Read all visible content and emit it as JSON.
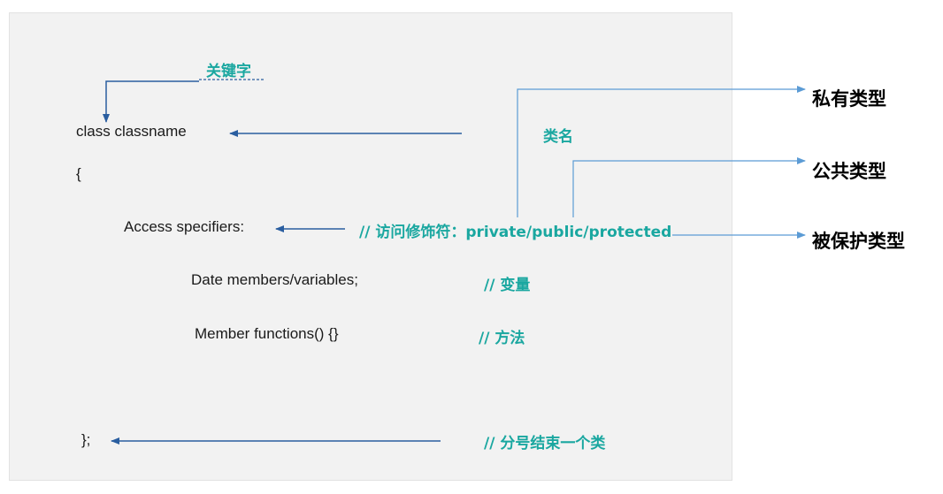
{
  "code": {
    "class_line": "class classname",
    "open_brace": "{",
    "access": "Access specifiers:",
    "members": "Date members/variables;",
    "functions": "Member functions() {}",
    "close": "};"
  },
  "notes": {
    "keyword": "关键字",
    "classname": "类名",
    "access": "// 访问修饰符：private/public/protected",
    "members": "// 变量",
    "functions": "// 方法",
    "close": "// 分号结束一个类"
  },
  "labels": {
    "private": "私有类型",
    "public": "公共类型",
    "protected": "被保护类型"
  },
  "colors": {
    "arrow_dark": "#2a5ea0",
    "arrow_light": "#5b9bd5",
    "note": "#1aa7a0",
    "panel": "#f2f2f2"
  }
}
